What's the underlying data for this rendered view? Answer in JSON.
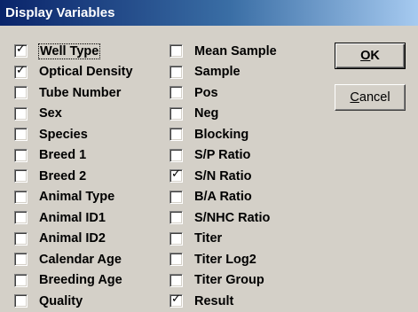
{
  "window": {
    "title": "Display Variables"
  },
  "buttons": {
    "ok": {
      "mnemonic": "O",
      "rest": "K"
    },
    "cancel": {
      "mnemonic": "C",
      "rest": "ancel"
    }
  },
  "check_mark": "✓",
  "columns": [
    [
      {
        "label": "Well Type",
        "checked": true,
        "focused": true
      },
      {
        "label": "Optical Density",
        "checked": true
      },
      {
        "label": "Tube Number",
        "checked": false
      },
      {
        "label": "Sex",
        "checked": false
      },
      {
        "label": "Species",
        "checked": false
      },
      {
        "label": "Breed 1",
        "checked": false
      },
      {
        "label": "Breed 2",
        "checked": false
      },
      {
        "label": "Animal Type",
        "checked": false
      },
      {
        "label": "Animal ID1",
        "checked": false
      },
      {
        "label": "Animal ID2",
        "checked": false
      },
      {
        "label": "Calendar Age",
        "checked": false
      },
      {
        "label": "Breeding Age",
        "checked": false
      },
      {
        "label": "Quality",
        "checked": false
      }
    ],
    [
      {
        "label": "Mean Sample",
        "checked": false
      },
      {
        "label": "Sample",
        "checked": false
      },
      {
        "label": "Pos",
        "checked": false
      },
      {
        "label": "Neg",
        "checked": false
      },
      {
        "label": "Blocking",
        "checked": false
      },
      {
        "label": "S/P Ratio",
        "checked": false
      },
      {
        "label": "S/N Ratio",
        "checked": true
      },
      {
        "label": "B/A Ratio",
        "checked": false
      },
      {
        "label": "S/NHC Ratio",
        "checked": false
      },
      {
        "label": "Titer",
        "checked": false
      },
      {
        "label": "Titer Log2",
        "checked": false
      },
      {
        "label": "Titer Group",
        "checked": false
      },
      {
        "label": "Result",
        "checked": true
      }
    ]
  ]
}
